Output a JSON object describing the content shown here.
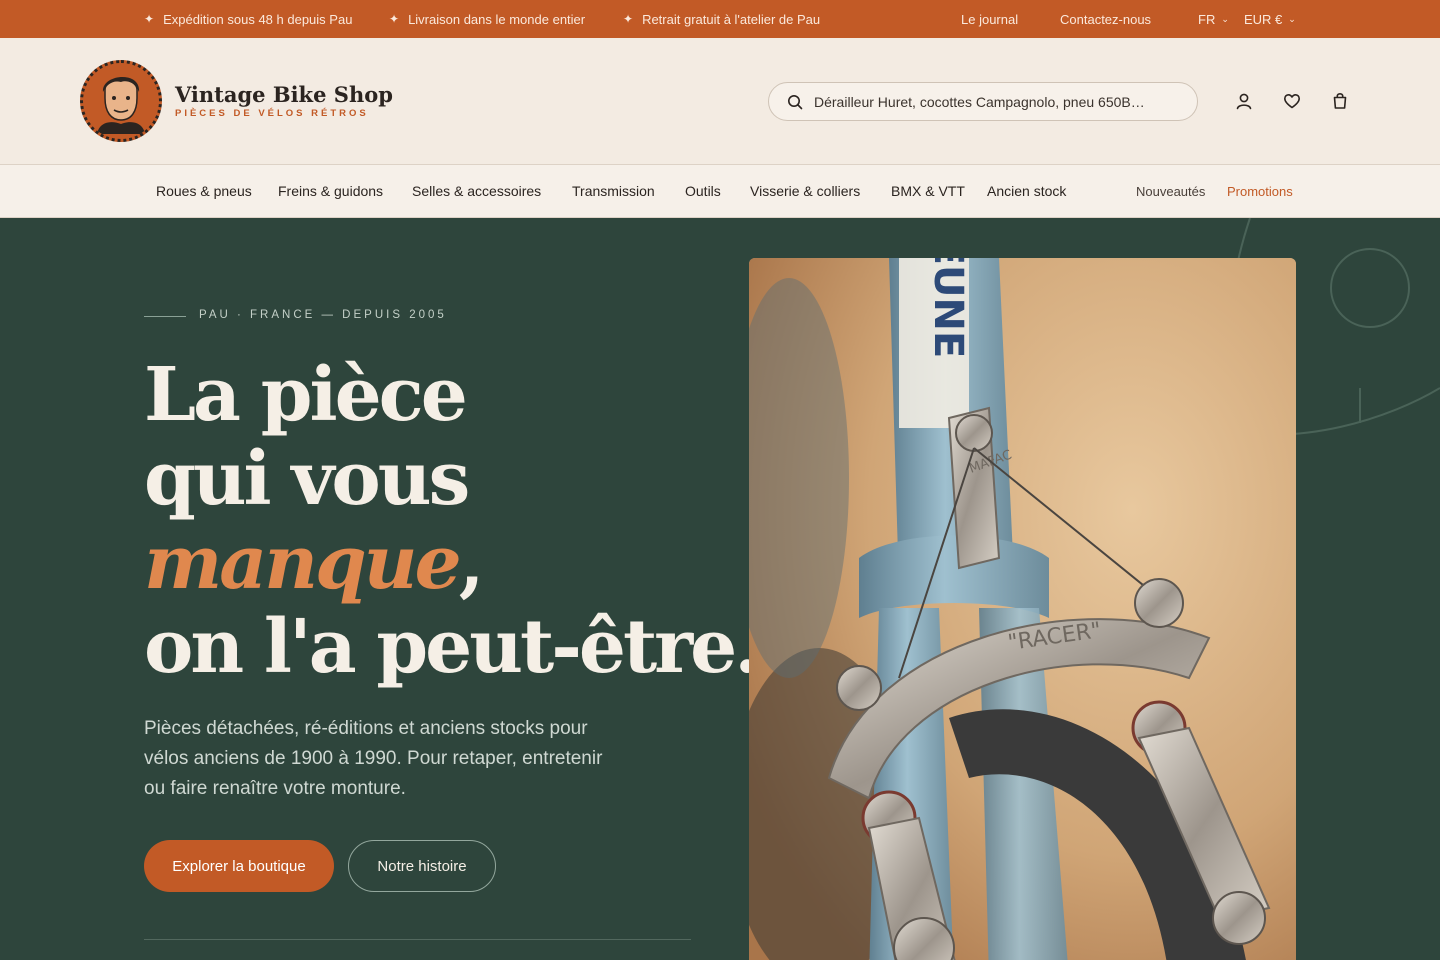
{
  "topbar": {
    "promos": [
      "Expédition sous 48 h depuis Pau",
      "Livraison dans le monde entier",
      "Retrait gratuit à l'atelier de Pau"
    ],
    "links": {
      "journal": "Le journal",
      "contact": "Contactez-nous",
      "language": "FR",
      "currency": "EUR €"
    }
  },
  "header": {
    "brand_name": "Vintage Bike Shop",
    "brand_tagline": "PIÈCES DE VÉLOS RÉTROS",
    "search_placeholder": "Dérailleur Huret, cocottes Campagnolo, pneu 650B…",
    "icons": [
      "user-icon",
      "heart-icon",
      "bag-icon"
    ]
  },
  "nav": {
    "categories": [
      "Roues & pneus",
      "Freins & guidons",
      "Selles & accessoires",
      "Transmission",
      "Outils",
      "Visserie & colliers",
      "BMX & VTT",
      "Ancien stock"
    ],
    "new_label": "Nouveautés",
    "promo_label": "Promotions"
  },
  "hero": {
    "eyebrow": "PAU · FRANCE — DEPUIS 2005",
    "headline": {
      "line1": "La pièce",
      "line2": "qui vous",
      "line3_em": "manque",
      "line3_rest": ",",
      "line4": "on l'a peut-être."
    },
    "lede": "Pièces détachées, ré-éditions et anciens stocks pour vélos anciens de 1900 à 1990. Pour retaper, entretenir ou faire renaître votre monture.",
    "primary_cta": "Explorer la boutique",
    "secondary_cta": "Notre histoire",
    "photo_frame_text": "EUNE",
    "photo_brake_brand": "MAFAC",
    "photo_brake_model": "\"RACER\""
  },
  "colors": {
    "accent": "#c25a26",
    "hero_bg": "#2e453c",
    "cream": "#f3ebe2",
    "highlight": "#e0884e"
  }
}
